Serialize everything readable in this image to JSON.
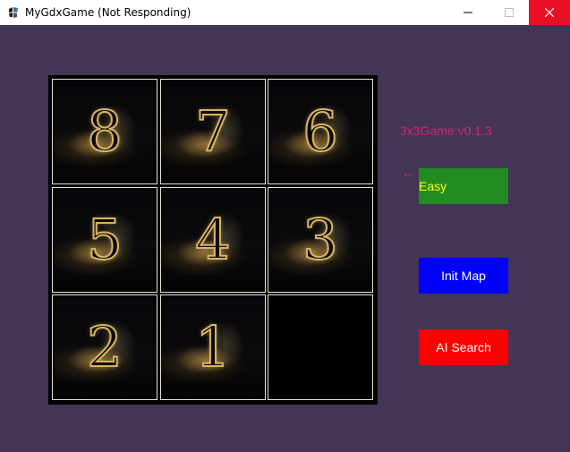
{
  "window": {
    "title": "MyGdxGame (Not Responding)",
    "app_icon": "gdx-app-icon",
    "close_color": "#e81123"
  },
  "board": {
    "tiles": [
      {
        "label": "8"
      },
      {
        "label": "7"
      },
      {
        "label": "6"
      },
      {
        "label": "5"
      },
      {
        "label": "4"
      },
      {
        "label": "3"
      },
      {
        "label": "2"
      },
      {
        "label": "1"
      },
      {
        "label": ""
      }
    ]
  },
  "info": {
    "version": "3x3Game:v0.1.3",
    "status": "--",
    "color": "#d4257d"
  },
  "buttons": {
    "difficulty": {
      "label": "Easy",
      "bg": "#228b22",
      "fg": "#ffff00"
    },
    "init_map": {
      "label": "Init Map",
      "bg": "#0000ff",
      "fg": "#ffffff"
    },
    "ai_search": {
      "label": "AI Search",
      "bg": "#ff0000",
      "fg": "#ffffff"
    }
  },
  "colors": {
    "background": "#433556",
    "board_bg": "#000000",
    "tile_border": "#e8e2d6",
    "numeral_gold": "#d9b464"
  }
}
